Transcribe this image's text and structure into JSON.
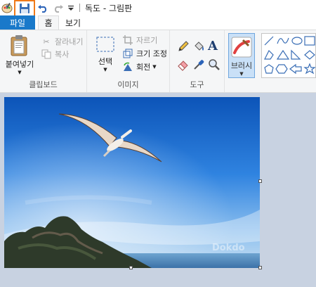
{
  "window": {
    "title": "독도 - 그림판"
  },
  "tabs": {
    "file": "파일",
    "home": "홈",
    "view": "보기"
  },
  "clipboard": {
    "paste": "붙여넣기",
    "cut": "잘라내기",
    "copy": "복사",
    "label": "클립보드"
  },
  "image": {
    "select": "선택",
    "crop": "자르기",
    "resize": "크기 조정",
    "rotate": "회전",
    "label": "이미지"
  },
  "tools": {
    "label": "도구",
    "text_glyph": "A"
  },
  "brushes": {
    "label": "브러시"
  },
  "colors": {
    "accent": "#1979ca",
    "save_highlight": "#f07a1a",
    "ribbon_bg": "#f5f6f7",
    "workspace_bg": "#c8d2e1"
  },
  "canvas_photo": {
    "watermark": "Dokdo"
  }
}
